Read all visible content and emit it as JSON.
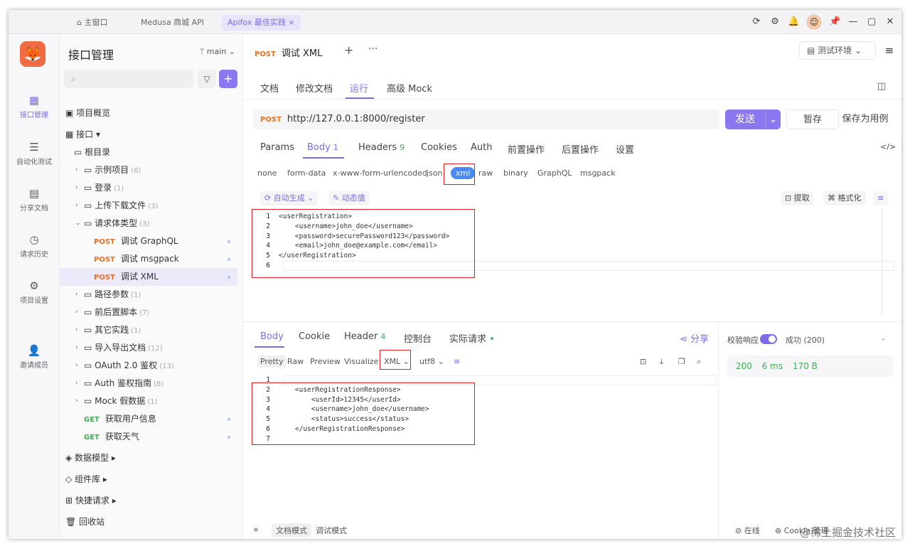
{
  "window": {
    "tabs": [
      {
        "label": "主窗口"
      },
      {
        "label": "Medusa 商城 API"
      },
      {
        "label": "Apifox 最佳实践"
      }
    ]
  },
  "rail": {
    "items": [
      {
        "label": "接口管理"
      },
      {
        "label": "自动化测试"
      },
      {
        "label": "分享文档"
      },
      {
        "label": "请求历史"
      },
      {
        "label": "项目设置"
      },
      {
        "label": "邀请成员"
      }
    ]
  },
  "tree": {
    "title": "接口管理",
    "branch": "main",
    "items": [
      {
        "label": "项目概览"
      },
      {
        "label": "接口"
      },
      {
        "label": "根目录"
      },
      {
        "label": "示例项目",
        "count": "(6)"
      },
      {
        "label": "登录",
        "count": "(1)"
      },
      {
        "label": "上传下载文件",
        "count": "(3)"
      },
      {
        "label": "请求体类型",
        "count": "(3)"
      },
      {
        "method": "POST",
        "label": "调试 GraphQL"
      },
      {
        "method": "POST",
        "label": "调试 msgpack"
      },
      {
        "method": "POST",
        "label": "调试 XML"
      },
      {
        "label": "路径参数",
        "count": "(1)"
      },
      {
        "label": "前后置脚本",
        "count": "(7)"
      },
      {
        "label": "其它实践",
        "count": "(1)"
      },
      {
        "label": "导入导出文档",
        "count": "(12)"
      },
      {
        "label": "OAuth 2.0 鉴权",
        "count": "(13)"
      },
      {
        "label": "Auth 鉴权指南",
        "count": "(8)"
      },
      {
        "label": "Mock 假数据",
        "count": "(1)"
      },
      {
        "method": "GET",
        "label": "获取用户信息"
      },
      {
        "method": "GET",
        "label": "获取天气"
      },
      {
        "label": "数据模型"
      },
      {
        "label": "组件库"
      },
      {
        "label": "快捷请求"
      },
      {
        "label": "回收站"
      }
    ]
  },
  "request": {
    "tab_method": "POST",
    "tab_name": "调试 XML",
    "env": "测试环境",
    "subtabs": [
      "文档",
      "修改文档",
      "运行",
      "高级 Mock"
    ],
    "method": "POST",
    "url": "http://127.0.0.1:8000/register",
    "send": "发送",
    "save": "暂存",
    "save_case": "保存为用例",
    "param_tabs": [
      {
        "label": "Params"
      },
      {
        "label": "Body",
        "n": "1"
      },
      {
        "label": "Headers",
        "n": "9"
      },
      {
        "label": "Cookies"
      },
      {
        "label": "Auth"
      },
      {
        "label": "前置操作"
      },
      {
        "label": "后置操作"
      },
      {
        "label": "设置"
      }
    ],
    "body_types": [
      "none",
      "form-data",
      "x-www-form-urlencoded",
      "json",
      "xml",
      "raw",
      "binary",
      "GraphQL",
      "msgpack"
    ],
    "auto_gen": "自动生成",
    "dynamic": "动态值",
    "extract": "提取",
    "format": "格式化",
    "code_lines": [
      "<userRegistration>",
      "    <username>john_doe</username>",
      "    <password>securePassword123</password>",
      "    <email>john_doe@example.com</email>",
      "</userRegistration>",
      ""
    ]
  },
  "response": {
    "tabs": [
      {
        "label": "Body"
      },
      {
        "label": "Cookie"
      },
      {
        "label": "Header",
        "n": "4"
      },
      {
        "label": "控制台"
      },
      {
        "label": "实际请求"
      }
    ],
    "share": "分享",
    "view_tabs": [
      "Pretty",
      "Raw",
      "Preview",
      "Visualize"
    ],
    "format": "XML",
    "encoding": "utf8",
    "code_lines": [
      "",
      "    <userRegistrationResponse>",
      "        <userId>12345</userId>",
      "        <username>john_doe</username>",
      "        <status>success</status>",
      "    </userRegistrationResponse>",
      ""
    ],
    "validate_label": "校验响应",
    "validate_result": "成功 (200)",
    "status": "200",
    "time": "6 ms",
    "size": "170 B"
  },
  "footer": {
    "doc_mode": "文档模式",
    "debug_mode": "调试模式",
    "online": "在线",
    "cookie": "Cookie 管理"
  },
  "watermark": "@稀土掘金技术社区"
}
